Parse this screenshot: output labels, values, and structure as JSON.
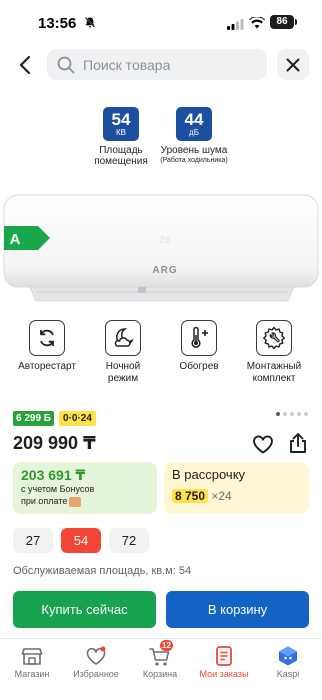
{
  "status_bar": {
    "time": "13:56",
    "battery": "86"
  },
  "search": {
    "placeholder": "Поиск товара"
  },
  "specs": [
    {
      "value": "54",
      "unit": "КВ",
      "label_line1": "Площадь",
      "label_line2": "помещения"
    },
    {
      "value": "44",
      "unit": "дБ",
      "label_line1": "Уровень шума",
      "label_line2": "(Работа ходильника)"
    }
  ],
  "product_image": {
    "brand": "ARG",
    "display": "26",
    "energy_class": "A"
  },
  "features": [
    {
      "icon": "autorestart-icon",
      "label_line1": "Авторестарт",
      "label_line2": ""
    },
    {
      "icon": "moon-cloud-icon",
      "label_line1": "Ночной",
      "label_line2": "режим"
    },
    {
      "icon": "thermometer-plus-icon",
      "label_line1": "Обогрев",
      "label_line2": ""
    },
    {
      "icon": "gear-wrench-icon",
      "label_line1": "Монтажный",
      "label_line2": "комплект"
    }
  ],
  "pagination": {
    "count": 5,
    "active": 0
  },
  "tags": {
    "bonus": "6 299 Б",
    "installment": "0·0·24"
  },
  "price": "209 990 ₸",
  "bonus_card": {
    "price": "203 691 ₸",
    "note_line1": "с учетом Бонусов",
    "note_line2": "при оплате"
  },
  "credit_card": {
    "title": "В рассрочку",
    "amount": "8 750",
    "months": "×24"
  },
  "area_options": [
    "27",
    "54",
    "72"
  ],
  "area_selected": "54",
  "area_caption": "Обслуживаемая площадь, кв.м: 54",
  "buttons": {
    "buy": "Купить сейчас",
    "cart": "В корзину"
  },
  "bottom_nav": [
    {
      "icon": "store-icon",
      "label": "Магазин"
    },
    {
      "icon": "heart-icon",
      "label": "Избранное"
    },
    {
      "icon": "cart-icon",
      "label": "Корзина",
      "badge": "12"
    },
    {
      "icon": "orders-icon",
      "label": "Мои заказы"
    },
    {
      "icon": "kaspi-assistant-icon",
      "label": "Kaspi"
    }
  ],
  "colors": {
    "accent": "#f14635",
    "buy": "#17a24d",
    "cart": "#1363c4",
    "spec_badge": "#1d4fa0",
    "bonus_green": "#2aa23c",
    "installment_yellow": "#ffe24a"
  }
}
